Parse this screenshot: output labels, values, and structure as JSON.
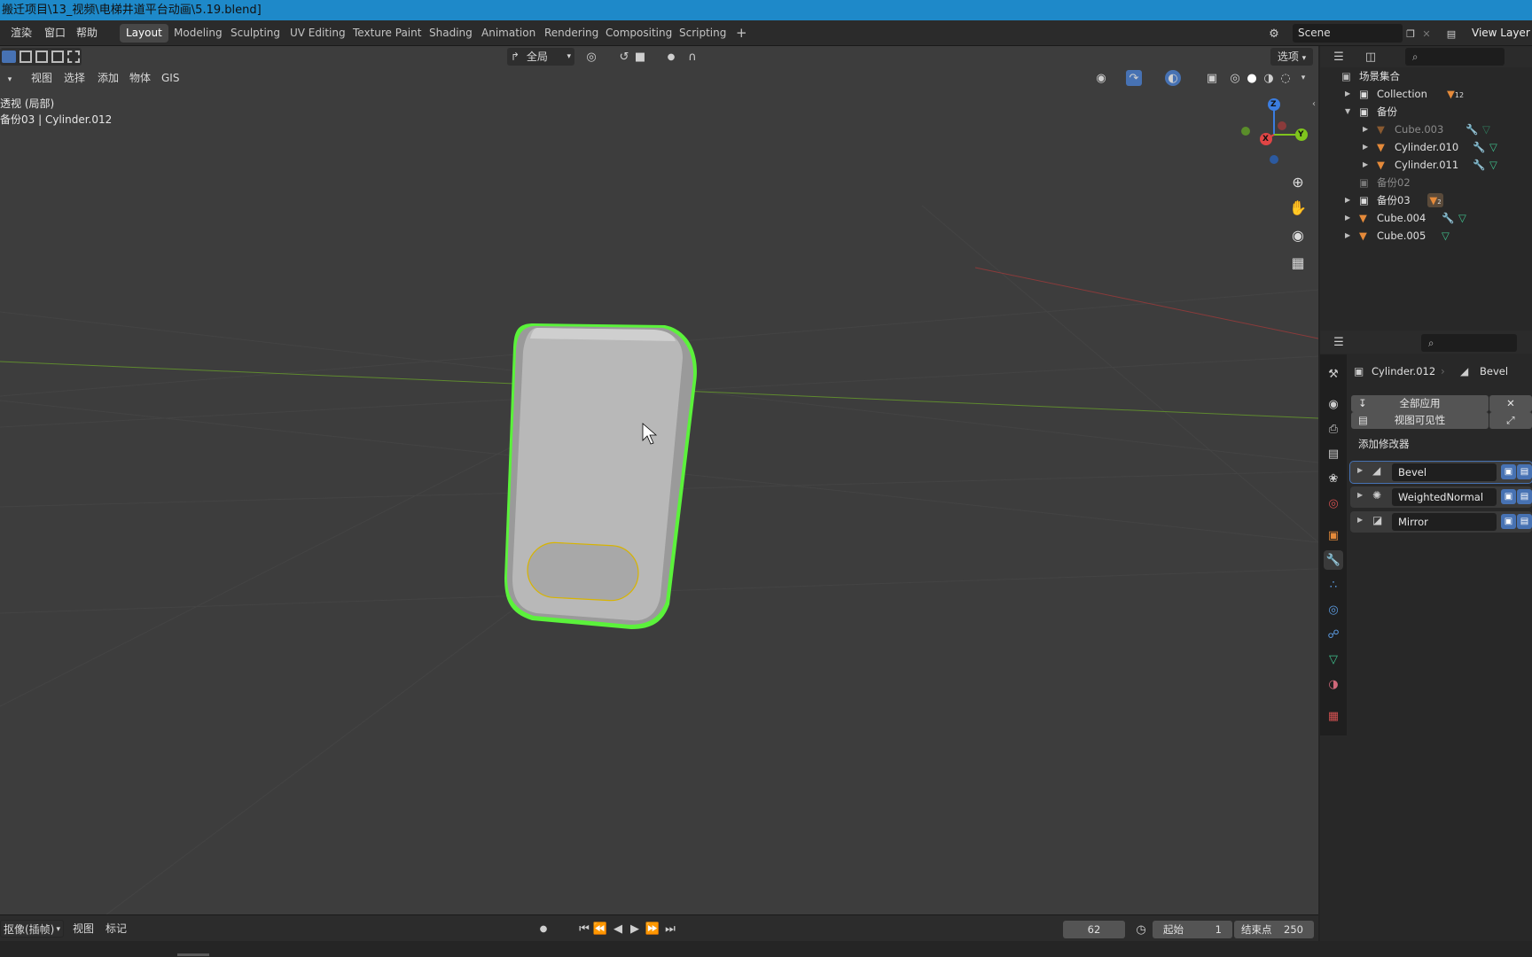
{
  "window": {
    "title": "搬迁项目\\13_视频\\电梯井道平台动画\\5.19.blend]"
  },
  "topbar": {
    "menus": [
      "渲染",
      "窗口",
      "帮助"
    ],
    "workspaces": [
      "Layout",
      "Modeling",
      "Sculpting",
      "UV Editing",
      "Texture Paint",
      "Shading",
      "Animation",
      "Rendering",
      "Compositing",
      "Scripting"
    ],
    "active_workspace": "Layout",
    "add_workspace": "+",
    "scene": "Scene",
    "view_layer": "View Layer"
  },
  "viewport": {
    "header_menus": [
      "视图",
      "选择",
      "添加",
      "物体",
      "GIS"
    ],
    "transform_orientation": "全局",
    "options_label": "选项",
    "view_name": "透视 (局部)",
    "object_info": "备份03 | Cylinder.012",
    "gizmo_axes": {
      "x": "X",
      "y": "Y",
      "z": "Z"
    }
  },
  "outliner": {
    "root": "场景集合",
    "items": [
      {
        "name": "Collection",
        "badge": "12",
        "dim": false
      },
      {
        "name": "备份",
        "dim": false
      },
      {
        "name": "Cube.003",
        "dim": true
      },
      {
        "name": "Cylinder.010",
        "dim": false
      },
      {
        "name": "Cylinder.011",
        "dim": false
      },
      {
        "name": "备份02",
        "dim": true
      },
      {
        "name": "备份03",
        "badge": "2",
        "dim": false
      },
      {
        "name": "Cube.004",
        "dim": false
      },
      {
        "name": "Cube.005",
        "dim": false
      }
    ]
  },
  "properties": {
    "object": "Cylinder.012",
    "active_modifier": "Bevel",
    "apply_all": "全部应用",
    "viewport_visibility": "视图可见性",
    "add_modifier": "添加修改器",
    "modifiers": [
      "Bevel",
      "WeightedNormal",
      "Mirror"
    ]
  },
  "timeline": {
    "playback_menu": "抠像(插帧)",
    "menus": [
      "视图",
      "标记"
    ],
    "current_frame": "62",
    "start_label": "起始",
    "start": "1",
    "end_label": "结束点",
    "end": "250"
  },
  "colors": {
    "accent_blue": "#4772b3",
    "selection_outline": "#5bf23b",
    "titlebar": "#1e89c9",
    "object_icon": "#e58a3a",
    "mesh_icon": "#3fc08d"
  }
}
